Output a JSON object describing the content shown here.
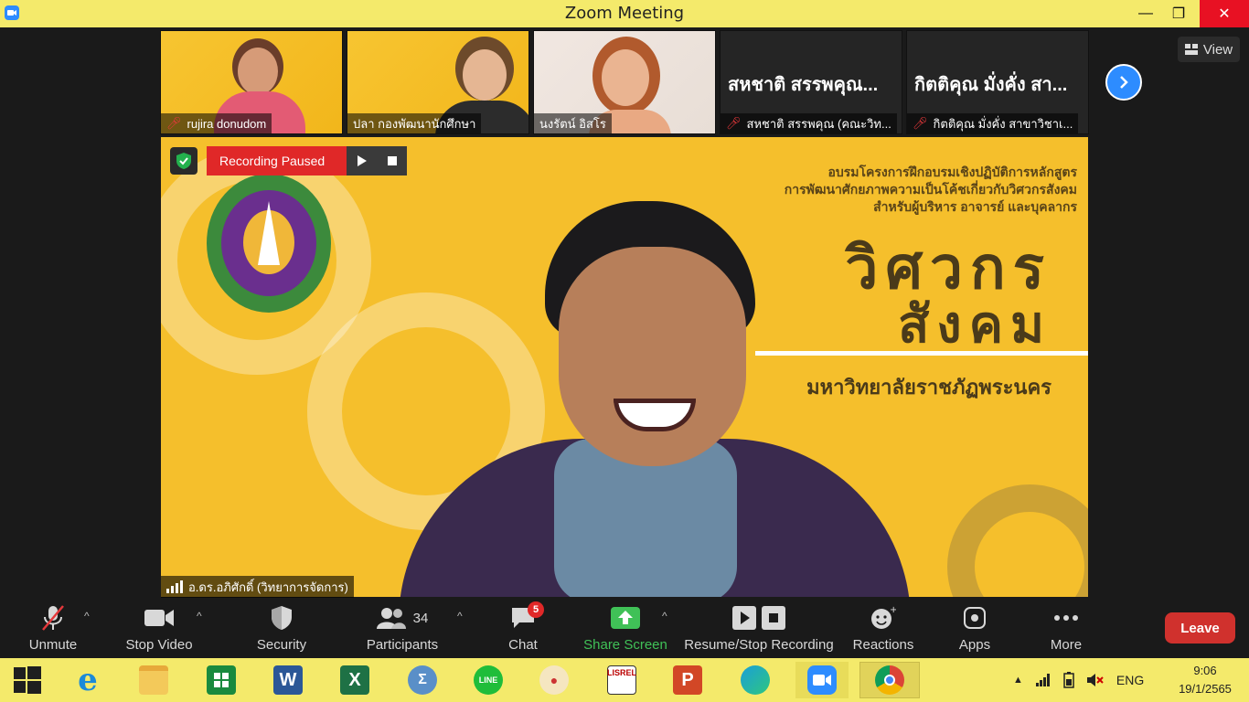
{
  "window": {
    "title": "Zoom Meeting",
    "minimize": "—",
    "maximize": "❐",
    "close": "✕"
  },
  "thumbnails": [
    {
      "name": "rujira donudom",
      "muted": true
    },
    {
      "name": "ปลา กองพัฒนานักศึกษา",
      "muted": false
    },
    {
      "name": "นงรัตน์ อิสโร",
      "muted": false
    },
    {
      "display_name": "สหชาติ สรรพคุณ...",
      "name": "สหชาติ สรรพคุณ (คณะวิท...",
      "muted": true
    },
    {
      "display_name": "กิตติคุณ  มั่งคั่ง สา...",
      "name": "กิตติคุณ  มั่งคั่ง สาขาวิชาเ...",
      "muted": true
    }
  ],
  "view_button": "View",
  "recording": {
    "status": "Recording Paused"
  },
  "banner": {
    "line1": "อบรมโครงการฝึกอบรมเชิงปฏิบัติการหลักสูตร",
    "line2": "การพัฒนาศักยภาพความเป็นโค้ชเกี่ยวกับวิศวกรสังคม",
    "line3": "สำหรับผู้บริหาร อาจารย์ และบุคลากร",
    "big1": "วิศวกร",
    "big2": "สังคม",
    "university": "มหาวิทยาลัยราชภัฏพระนคร"
  },
  "speaker": {
    "name": "อ.ดร.อภิศักดิ์ (วิทยาการจัดการ)"
  },
  "toolbar": {
    "unmute": "Unmute",
    "stop_video": "Stop Video",
    "security": "Security",
    "participants": "Participants",
    "participants_count": "34",
    "chat": "Chat",
    "chat_badge": "5",
    "share_screen": "Share Screen",
    "recording": "Resume/Stop Recording",
    "reactions": "Reactions",
    "apps": "Apps",
    "more": "More",
    "leave": "Leave"
  },
  "taskbar": {
    "apps": [
      "windows-start",
      "internet-explorer",
      "file-explorer",
      "microsoft-store",
      "word",
      "excel",
      "math-input",
      "line",
      "paint",
      "lisrel",
      "powerpoint",
      "edge",
      "zoom",
      "chrome"
    ],
    "word_letter": "W",
    "excel_letter": "X",
    "line_label": "LINE",
    "powerpoint_letter": "P",
    "lisrel_label": "LISREL",
    "language": "ENG",
    "time": "9:06",
    "date": "19/1/2565"
  },
  "colors": {
    "title_bar": "#f4ea6b",
    "zoom_blue": "#2d8cff",
    "leave_red": "#d0312d",
    "recording_red": "#e02828",
    "share_green": "#40c157",
    "slide_yellow": "#f5bf2c"
  }
}
